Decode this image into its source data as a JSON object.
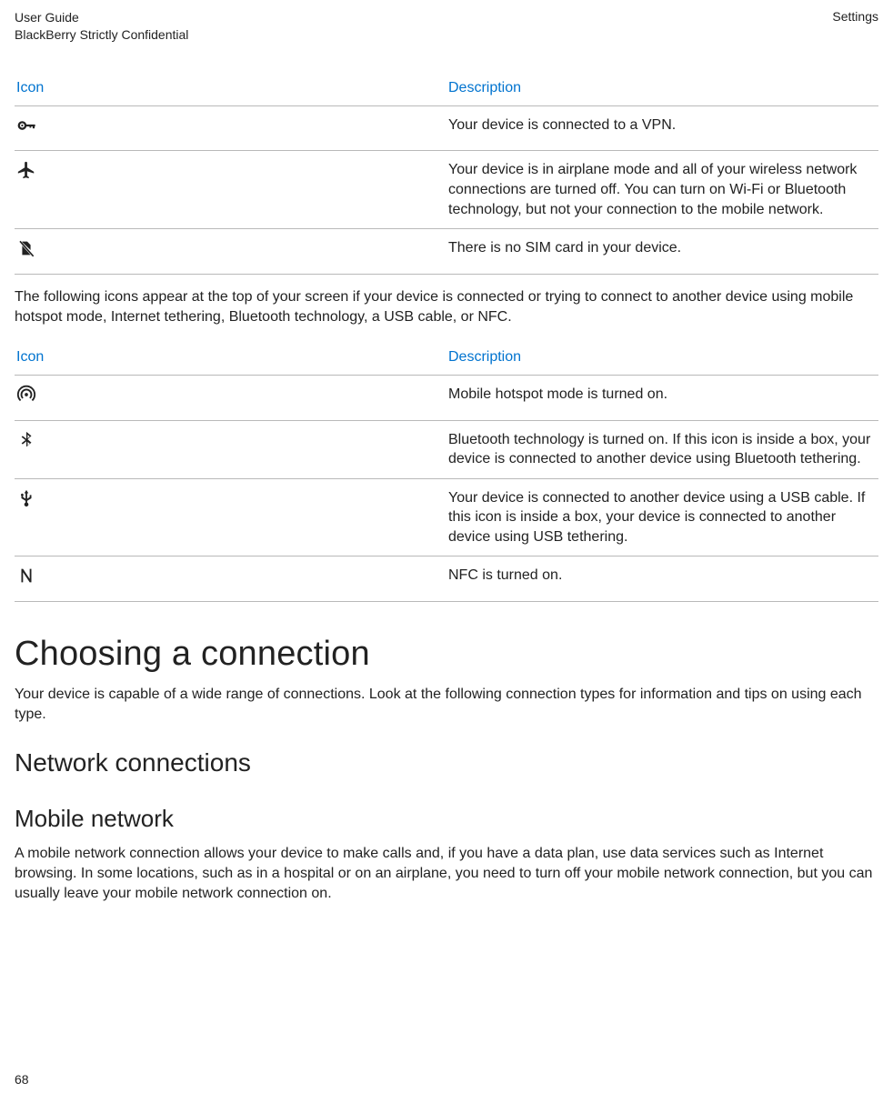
{
  "header": {
    "left_line1": "User Guide",
    "left_line2": "BlackBerry Strictly Confidential",
    "right": "Settings"
  },
  "table1": {
    "col_icon": "Icon",
    "col_desc": "Description",
    "rows": [
      {
        "icon_name": "key-icon",
        "desc": "Your device is connected to a VPN."
      },
      {
        "icon_name": "airplane-icon",
        "desc": "Your device is in airplane mode and all of your wireless network connections are turned off. You can turn on Wi-Fi or Bluetooth technology, but not your connection to the mobile network."
      },
      {
        "icon_name": "no-sim-icon",
        "desc": "There is no SIM card in your device."
      }
    ]
  },
  "middle_paragraph": "The following icons appear at the top of your screen if your device is connected or trying to connect to another device using mobile hotspot mode, Internet tethering, Bluetooth technology, a USB cable, or NFC.",
  "table2": {
    "col_icon": "Icon",
    "col_desc": "Description",
    "rows": [
      {
        "icon_name": "hotspot-icon",
        "desc": "Mobile hotspot mode is turned on."
      },
      {
        "icon_name": "bluetooth-icon",
        "desc": "Bluetooth technology is turned on. If this icon is inside a box, your device is connected to another device using Bluetooth tethering."
      },
      {
        "icon_name": "usb-icon",
        "desc": "Your device is connected to another device using a USB cable. If this icon is inside a box, your device is connected to another device using USB tethering."
      },
      {
        "icon_name": "nfc-icon",
        "desc": "NFC is turned on."
      }
    ]
  },
  "sections": {
    "h1": "Choosing a connection",
    "p1": "Your device is capable of a wide range of connections. Look at the following connection types for information and tips on using each type.",
    "h2": "Network connections",
    "h3": "Mobile network",
    "p2": "A mobile network connection allows your device to make calls and, if you have a data plan, use data services such as Internet browsing. In some locations, such as in a hospital or on an airplane, you need to turn off your mobile network connection, but you can usually leave your mobile network connection on."
  },
  "page_number": "68"
}
